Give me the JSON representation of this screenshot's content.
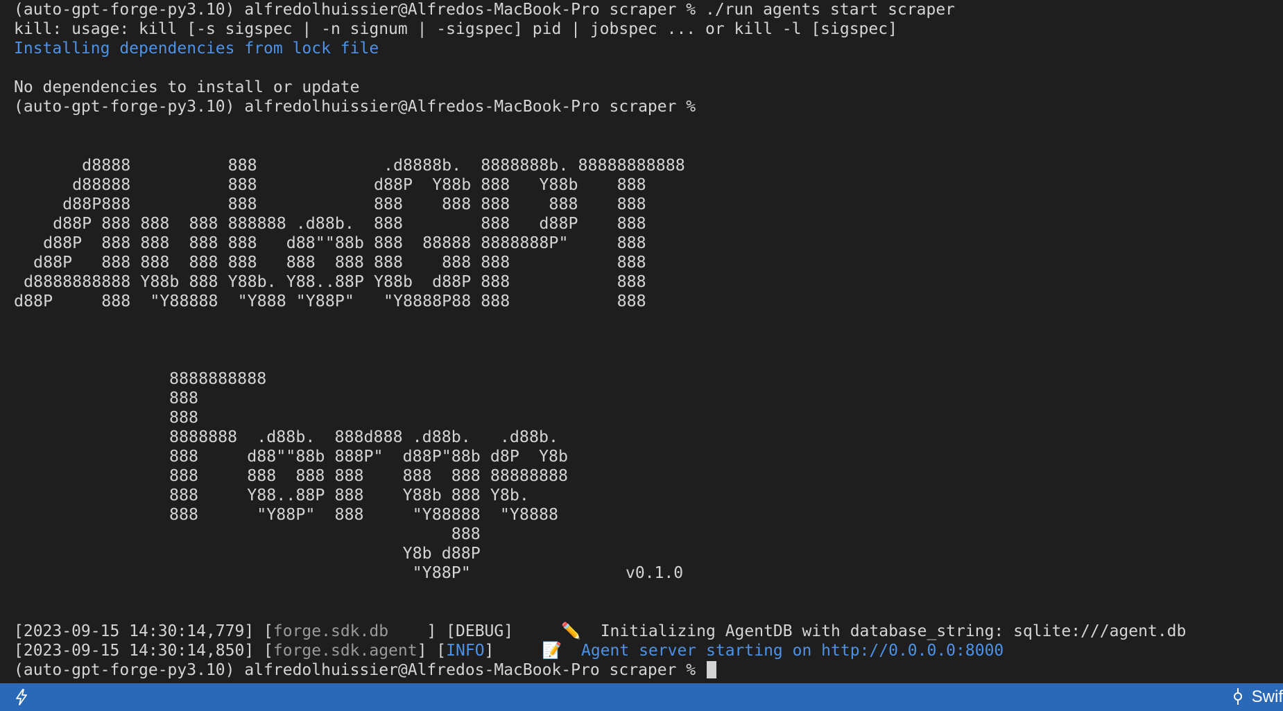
{
  "terminal": {
    "lines": [
      "(auto-gpt-forge-py3.10) alfredolhuissier@Alfredos-MacBook-Pro scraper % ./run agents start scraper",
      "kill: usage: kill [-s sigspec | -n signum | -sigspec] pid | jobspec ... or kill -l [sigspec]",
      "Installing dependencies from lock file",
      "No dependencies to install or update",
      "(auto-gpt-forge-py3.10) alfredolhuissier@Alfredos-MacBook-Pro scraper %"
    ],
    "banner_autogpt": "       d8888          888             .d8888b.  8888888b. 88888888888\n      d88888          888            d88P  Y88b 888   Y88b    888\n     d88P888          888            888    888 888    888    888\n    d88P 888 888  888 888888 .d88b.  888        888   d88P    888\n   d88P  888 888  888 888   d88\"\"88b 888  88888 8888888P\"     888\n  d88P   888 888  888 888   888  888 888    888 888           888\n d8888888888 Y88b 888 Y88b. Y88..88P Y88b  d88P 888           888\nd88P     888  \"Y88888  \"Y888 \"Y88P\"   \"Y8888P88 888           888",
    "banner_forge": "8888888888\n888\n888\n8888888  .d88b.  888d888 .d88b.   .d88b.\n888     d88\"\"88b 888P\"  d88P\"88b d8P  Y8b\n888     888  888 888    888  888 88888888\n888     Y88..88P 888    Y88b 888 Y8b.\n888      \"Y88P\"  888     \"Y88888  \"Y8888\n                             888\n                        Y8b d88P\n                         \"Y88P\"",
    "version": "v0.1.0",
    "log": [
      {
        "timestamp": "[2023-09-15 14:30:14,779]",
        "logger": "forge.sdk.db",
        "logger_pad": "    ",
        "level": "DEBUG",
        "emoji": "✏️",
        "message": "Initializing AgentDB with database_string: sqlite:///agent.db"
      },
      {
        "timestamp": "[2023-09-15 14:30:14,850]",
        "logger": "forge.sdk.agent",
        "logger_pad": "",
        "level": "INFO",
        "emoji": "📝",
        "message": "Agent server starting on http://0.0.0.0:8000"
      }
    ],
    "prompt": "(auto-gpt-forge-py3.10) alfredolhuissier@Alfredos-MacBook-Pro scraper % "
  },
  "statusbar": {
    "right_label": "Swif",
    "colors": {
      "background": "#2a69b8",
      "text": "#ffffff"
    },
    "icons": [
      "lightning-icon",
      "git-commit-icon"
    ]
  },
  "colors": {
    "background": "#1e1e1e",
    "foreground": "#d4d4d4",
    "accent_blue": "#4d92e6"
  }
}
